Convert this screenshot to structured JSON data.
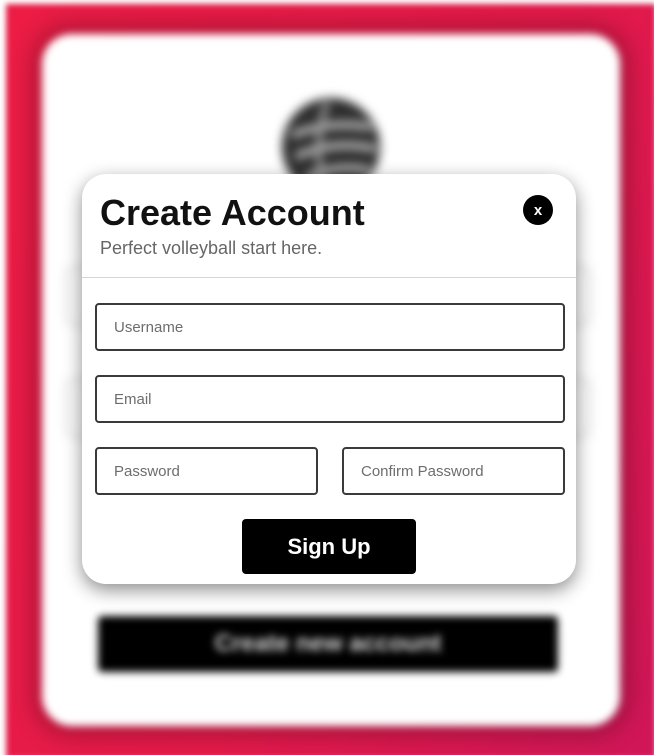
{
  "background": {
    "gradient_colors": [
      "#ec1c45",
      "#cf1658"
    ],
    "logo_icon": "volleyball-icon",
    "button_label": "Create new account"
  },
  "modal": {
    "title": "Create Account",
    "subtitle": "Perfect volleyball start here.",
    "close_label": "x",
    "fields": {
      "username": {
        "placeholder": "Username",
        "value": ""
      },
      "email": {
        "placeholder": "Email",
        "value": ""
      },
      "password": {
        "placeholder": "Password",
        "value": ""
      },
      "confirm_password": {
        "placeholder": "Confirm Password",
        "value": ""
      }
    },
    "submit_label": "Sign Up",
    "accent_color": "#000000"
  }
}
